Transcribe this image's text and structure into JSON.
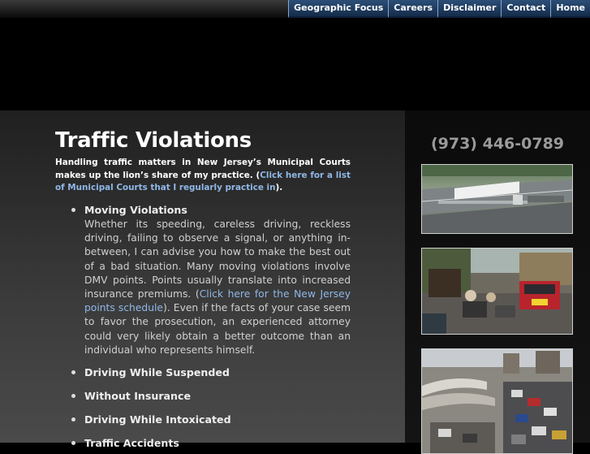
{
  "nav": {
    "items": [
      "Geographic Focus",
      "Careers",
      "Disclaimer",
      "Contact",
      "Home"
    ]
  },
  "main": {
    "title": "Traffic Violations",
    "intro": {
      "text": "Handling traffic matters in New Jersey’s Municipal Courts makes up the lion’s share of my practice. (",
      "link": "Click here for a list of Municipal Courts that I regularly practice in",
      "end": ")."
    },
    "items": [
      {
        "heading": "Moving Violations",
        "text1": "Whether its speeding, careless driving, reckless driving, failing to observe a signal, or anything in-between, I can advise you how to make the best out of a bad situation. Many moving violations involve DMV points. Points usually translate into increased insurance premiums. (",
        "link": "Click here for the New Jersey points schedule",
        "text2": "). Even if the facts of your case seem to favor the prosecution, an experienced attorney could very likely obtain a better outcome than an individual who represents himself."
      },
      {
        "heading": "Driving While Suspended"
      },
      {
        "heading": "Without Insurance"
      },
      {
        "heading": "Driving While Intoxicated"
      },
      {
        "heading": "Traffic Accidents"
      }
    ]
  },
  "sidebar": {
    "phone": "(973) 446-0789",
    "photos": [
      "highway-truck-photo",
      "busy-street-photo",
      "traffic-jam-photo"
    ]
  }
}
